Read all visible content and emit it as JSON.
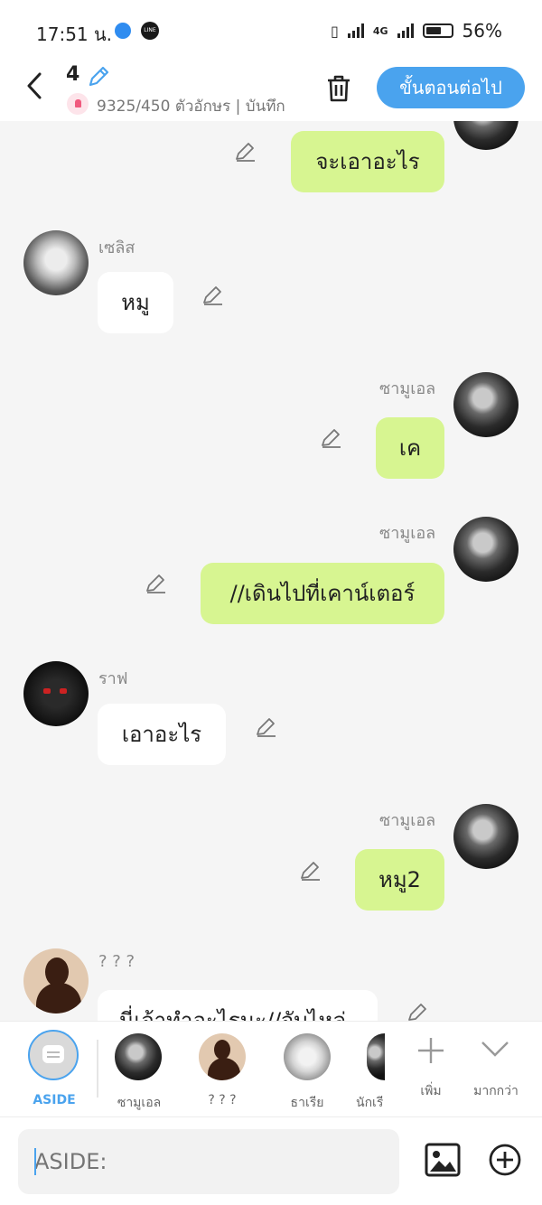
{
  "status_bar": {
    "time": "17:51 น.",
    "network_label": "4G",
    "battery": "56%"
  },
  "header": {
    "episode_number": "4",
    "char_count": "9325/450 ตัวอักษร | บันทึก",
    "next_button": "ขั้นตอนต่อไป"
  },
  "messages": [
    {
      "side": "right",
      "name": "",
      "text": "จะเอาอะไร",
      "avatar": "samuel"
    },
    {
      "side": "left",
      "name": "เซลิส",
      "text": "หมู",
      "avatar": "selis"
    },
    {
      "side": "right",
      "name": "ซามูเอล",
      "text": "เค",
      "avatar": "samuel"
    },
    {
      "side": "right",
      "name": "ซามูเอล",
      "text": "//เดินไปที่เคาน์เตอร์",
      "avatar": "samuel"
    },
    {
      "side": "left",
      "name": "ราฟ",
      "text": "เอาอะไร",
      "avatar": "raf"
    },
    {
      "side": "right",
      "name": "ซามูเอล",
      "text": "หมู2",
      "avatar": "samuel"
    },
    {
      "side": "left",
      "name": "? ? ?",
      "text": "นี่เจ้าทำอะไรนะ//จับไหล่",
      "avatar": "unknown"
    }
  ],
  "cast_bar": {
    "aside_label": "ASIDE",
    "characters": [
      "ซามูเอล",
      "? ? ?",
      "ธาเรีย",
      "นักเรี"
    ],
    "add_label": "เพิ่ม",
    "more_label": "มากกว่า"
  },
  "composer": {
    "placeholder": "ASIDE:"
  },
  "colors": {
    "accent": "#4aa3ee",
    "right_bubble": "#d7f591",
    "left_bubble": "#ffffff",
    "background": "#f5f5f5"
  },
  "icons": [
    "back-arrow-icon",
    "pencil-icon",
    "bell-icon",
    "trash-icon",
    "edit-icon",
    "plus-icon",
    "chevron-down-icon",
    "image-icon",
    "add-circle-icon"
  ]
}
